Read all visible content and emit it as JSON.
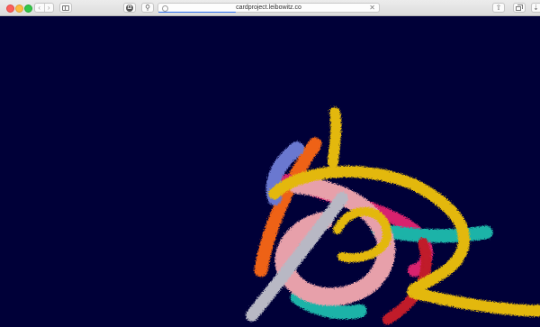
{
  "browser": {
    "url": "cardproject.leibowitz.co",
    "page_load_progress_percent": 35,
    "nav_back_glyph": "‹",
    "nav_forward_glyph": "›",
    "accessibility_glyph": "⚲",
    "reader_glyph": "Ω",
    "share_glyph": "⇧",
    "download_glyph": "⇣",
    "stop_glyph": "✕"
  },
  "icons": {
    "traffic_close": "close-icon",
    "traffic_minimize": "minimize-icon",
    "traffic_maximize": "maximize-icon",
    "back": "chevron-left-icon",
    "forward": "chevron-right-icon",
    "sidebar": "sidebar-icon",
    "shield": "shield-icon",
    "share": "share-icon",
    "tabs": "tabs-icon",
    "download": "download-icon"
  },
  "colors": {
    "page_background": "#000038",
    "tinsel_gold": "#e3b80e",
    "tinsel_pink": "#e7a0aa",
    "tinsel_silver": "#b8b8c4",
    "tinsel_teal": "#1fb3a8",
    "tinsel_orange": "#ee6218",
    "tinsel_magenta": "#d8236e",
    "tinsel_blue": "#6a78d0",
    "tinsel_red": "#c01a2a"
  }
}
